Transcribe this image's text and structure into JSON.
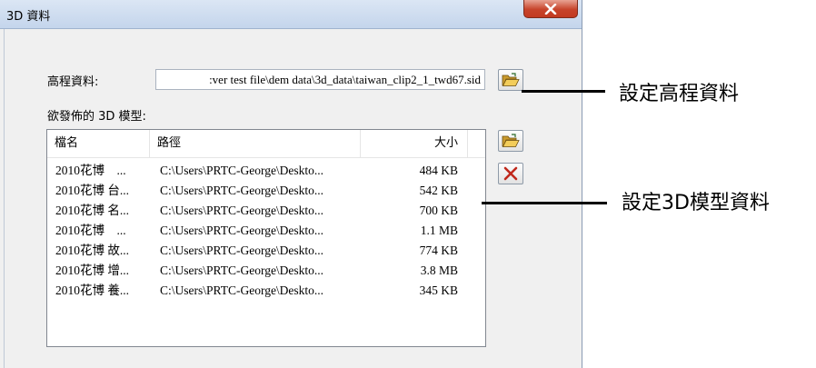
{
  "window": {
    "title": "3D 資料",
    "close_glyph": "✕"
  },
  "dem": {
    "label": "高程資料:",
    "value": ":ver test file\\dem data\\3d_data\\taiwan_clip2_1_twd67.sid"
  },
  "models": {
    "label": "欲發佈的 3D 模型:",
    "columns": [
      "檔名",
      "路徑",
      "大小"
    ],
    "rows": [
      {
        "name": "2010花博　...",
        "path": "C:\\Users\\PRTC-George\\Deskto...",
        "size": "484 KB"
      },
      {
        "name": "2010花博 台...",
        "path": "C:\\Users\\PRTC-George\\Deskto...",
        "size": "542 KB"
      },
      {
        "name": "2010花博 名...",
        "path": "C:\\Users\\PRTC-George\\Deskto...",
        "size": "700 KB"
      },
      {
        "name": "2010花博　...",
        "path": "C:\\Users\\PRTC-George\\Deskto...",
        "size": "1.1 MB"
      },
      {
        "name": "2010花博 故...",
        "path": "C:\\Users\\PRTC-George\\Deskto...",
        "size": "774 KB"
      },
      {
        "name": "2010花博 增...",
        "path": "C:\\Users\\PRTC-George\\Deskto...",
        "size": "3.8 MB"
      },
      {
        "name": "2010花博 養...",
        "path": "C:\\Users\\PRTC-George\\Deskto...",
        "size": "345 KB"
      }
    ]
  },
  "annotations": {
    "dem_callout": "設定高程資料",
    "model_callout": "設定3D模型資料"
  },
  "icons": {
    "dem_browse": "folder-open-icon",
    "model_add": "folder-open-icon",
    "model_remove": "delete-x-icon",
    "close": "close-icon"
  },
  "colors": {
    "close_button": "#c7432b",
    "remove_icon": "#c0281c",
    "folder_icon": "#e8b83a"
  }
}
